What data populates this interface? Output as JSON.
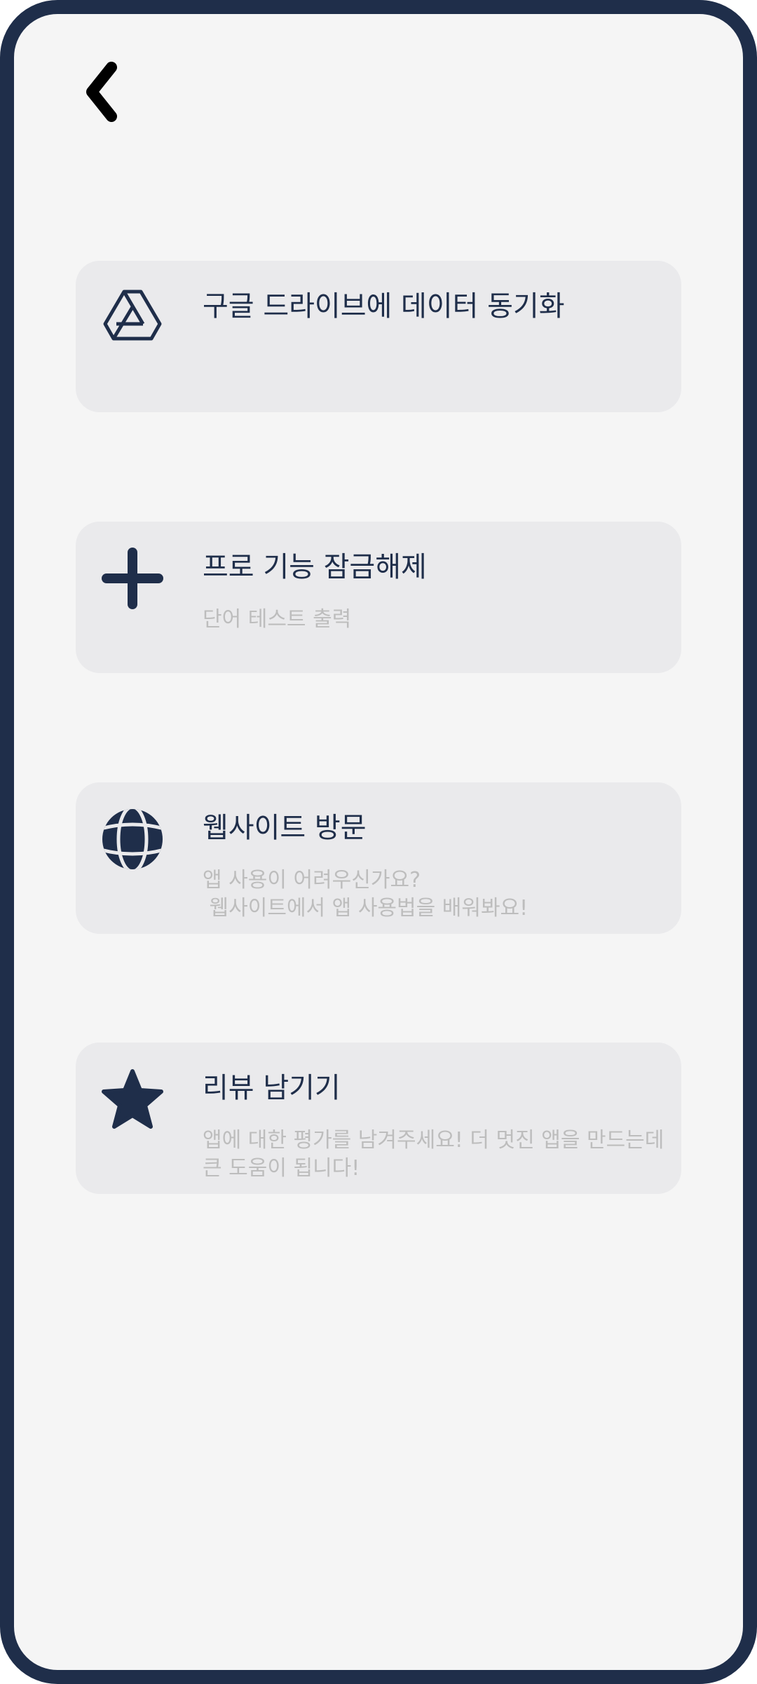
{
  "header": {
    "back_icon": "chevron-left-icon"
  },
  "menu": {
    "items": [
      {
        "icon": "google-drive-icon",
        "title": "구글 드라이브에 데이터 동기화",
        "subtitle": ""
      },
      {
        "icon": "plus-icon",
        "title": "프로 기능 잠금해제",
        "subtitle": "단어 테스트 출력"
      },
      {
        "icon": "globe-icon",
        "title": "웹사이트 방문",
        "subtitle": "앱 사용이 어려우신가요?\n 웹사이트에서 앱 사용법을 배워봐요!"
      },
      {
        "icon": "star-icon",
        "title": "리뷰 남기기",
        "subtitle": "앱에 대한 평가를 남겨주세요! 더 멋진 앱을 만드는데 큰 도움이 됩니다!"
      }
    ]
  },
  "colors": {
    "frame": "#1f2e4a",
    "background": "#f5f5f5",
    "card": "#eaeaec",
    "title_text": "#1f2e4a",
    "subtitle_text": "#bdbdbd",
    "icon": "#1f2e4a"
  }
}
